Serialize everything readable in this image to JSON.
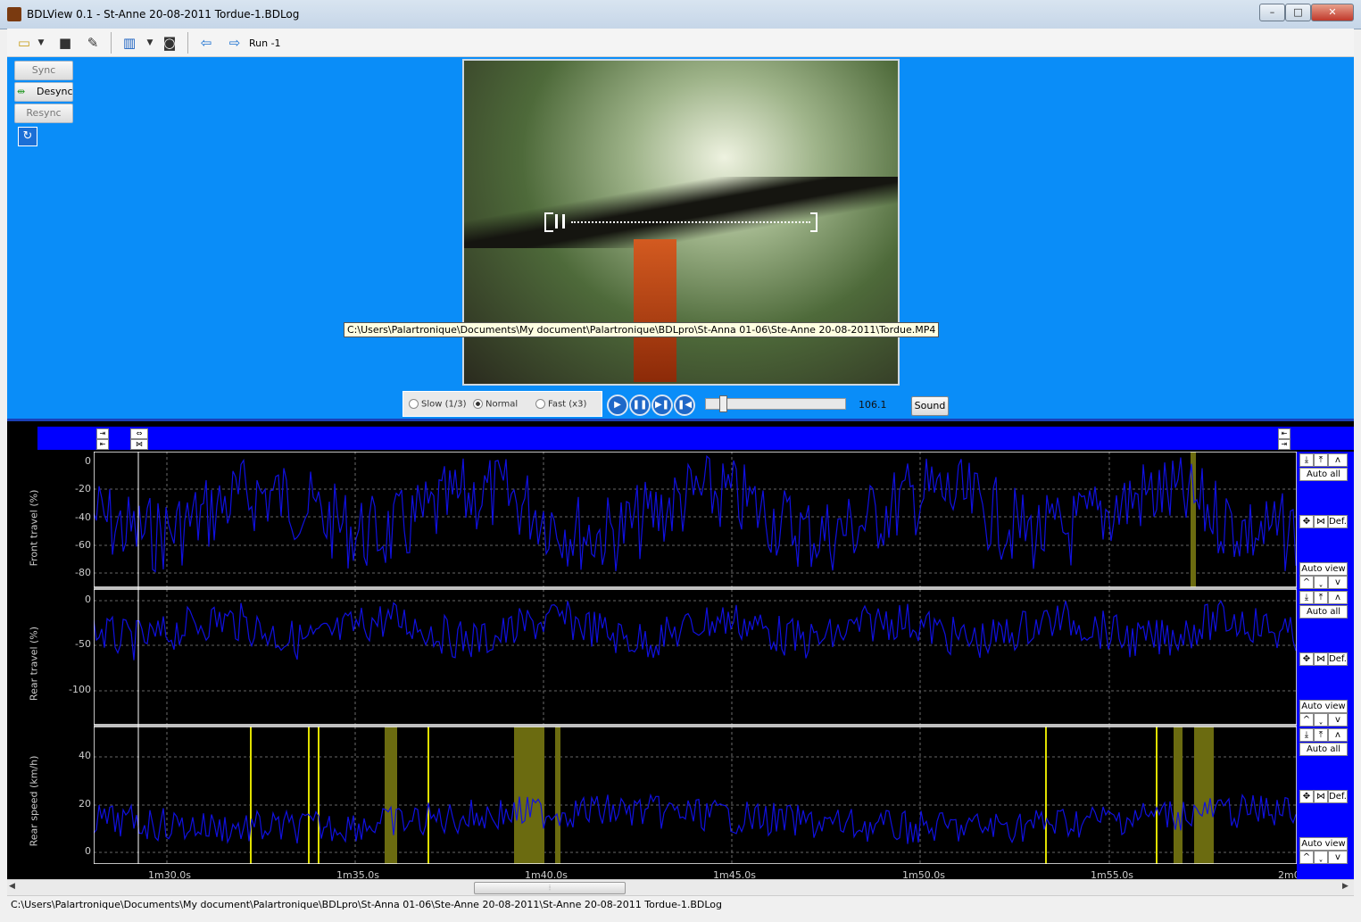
{
  "window": {
    "title": "BDLView 0.1 - St-Anne 20-08-2011 Tordue-1.BDLog",
    "minimize": "–",
    "maximize": "□",
    "close": "✕"
  },
  "toolbar": {
    "run_label": "Run -1"
  },
  "sync_buttons": {
    "sync": "Sync",
    "desync": "Desync",
    "resync": "Resync"
  },
  "video": {
    "tooltip": "C:\\Users\\Palartronique\\Documents\\My document\\Palartronique\\BDLpro\\St-Anna 01-06\\Ste-Anne 20-08-2011\\Tordue.MP4"
  },
  "playback": {
    "speed_options": [
      "Slow (1/3)",
      "Normal",
      "Fast (x3)"
    ],
    "selected_speed": "Normal",
    "slider_value": "106.1",
    "sound_label": "Sound"
  },
  "graphs": {
    "panels": [
      {
        "ylabel": "Front travel (%)",
        "yticks": [
          "0",
          "-20",
          "-40",
          "-60",
          "-80"
        ]
      },
      {
        "ylabel": "Rear travel (%)",
        "yticks": [
          "0",
          "-50",
          "-100"
        ]
      },
      {
        "ylabel": "Rear speed (km/h)",
        "yticks": [
          "40",
          "20",
          "0"
        ]
      }
    ],
    "xticks": [
      "1m30.0s",
      "1m35.0s",
      "1m40.0s",
      "1m45.0s",
      "1m50.0s",
      "1m55.0s",
      "2m0"
    ],
    "auto_all": "Auto all",
    "def": "Def.",
    "auto_view": "Auto view"
  },
  "status_bar": {
    "path": "C:\\Users\\Palartronique\\Documents\\My document\\Palartronique\\BDLpro\\St-Anna 01-06\\Ste-Anne 20-08-2011\\St-Anne 20-08-2011 Tordue-1.BDLog"
  },
  "colors": {
    "accent_blue": "#0a8df8",
    "plot_line": "#1010e0",
    "highlight": "#6b6b10"
  }
}
